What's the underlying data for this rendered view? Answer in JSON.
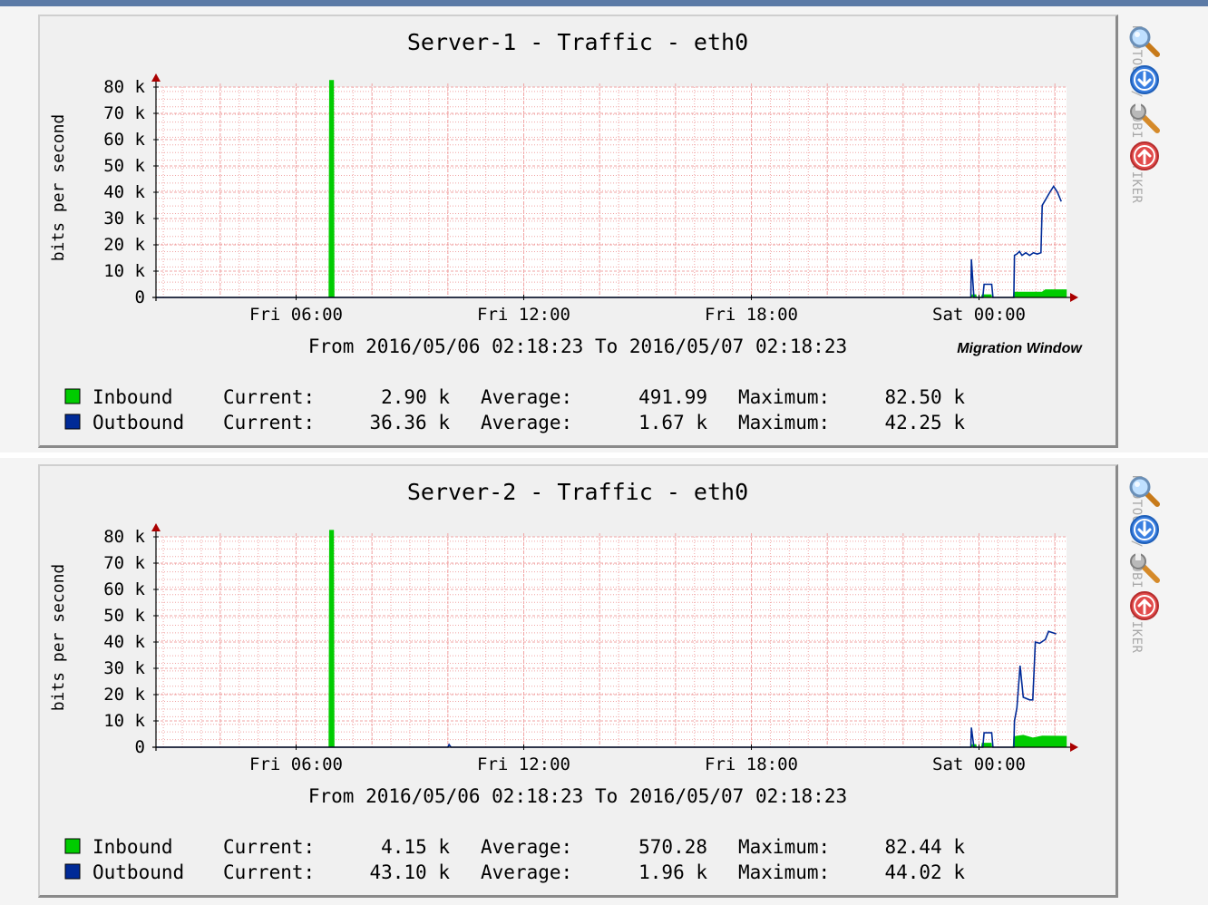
{
  "credit": "RRDTOOL / TOBI OETIKER",
  "tools": [
    "zoom-icon",
    "download-icon",
    "settings-icon",
    "upload-icon"
  ],
  "colors": {
    "inbound": "#00cc00",
    "outbound": "#002a97",
    "grid": "#f1a5a5",
    "axis": "#aa0000",
    "text": "#000000"
  },
  "chart_data": [
    {
      "type": "area",
      "title": "Server-1 - Traffic - eth0",
      "ylabel": "bits per second",
      "ylim": [
        0,
        80000
      ],
      "yticks": [
        0,
        10000,
        20000,
        30000,
        40000,
        50000,
        60000,
        70000,
        80000
      ],
      "ytick_labels": [
        "0",
        "10 k",
        "20 k",
        "30 k",
        "40 k",
        "50 k",
        "60 k",
        "70 k",
        "80 k"
      ],
      "xlim": [
        "2016-05-06 02:18:23",
        "2016-05-07 02:18:23"
      ],
      "xticks": [
        "2016-05-06 06:00",
        "2016-05-06 12:00",
        "2016-05-06 18:00",
        "2016-05-07 00:00"
      ],
      "xtick_labels": [
        "Fri 06:00",
        "Fri 12:00",
        "Fri 18:00",
        "Sat 00:00"
      ],
      "grid": true,
      "time_range": "From 2016/05/06 02:18:23 To 2016/05/07 02:18:23",
      "annotation": "Migration Window",
      "series": [
        {
          "name": "Inbound",
          "style": "area",
          "points": [
            [
              "2016-05-06 02:18:23",
              0
            ],
            [
              "2016-05-06 06:52",
              0
            ],
            [
              "2016-05-06 06:53",
              82500
            ],
            [
              "2016-05-06 06:59",
              82500
            ],
            [
              "2016-05-06 07:00",
              0
            ],
            [
              "2016-05-06 23:48",
              0
            ],
            [
              "2016-05-06 23:49",
              1000
            ],
            [
              "2016-05-06 23:55",
              1000
            ],
            [
              "2016-05-06 23:56",
              0
            ],
            [
              "2016-05-07 00:04",
              0
            ],
            [
              "2016-05-07 00:05",
              1000
            ],
            [
              "2016-05-07 00:19",
              1000
            ],
            [
              "2016-05-07 00:20",
              0
            ],
            [
              "2016-05-07 00:54",
              0
            ],
            [
              "2016-05-07 00:55",
              2000
            ],
            [
              "2016-05-07 01:40",
              2000
            ],
            [
              "2016-05-07 01:45",
              2900
            ],
            [
              "2016-05-07 02:18",
              2900
            ]
          ],
          "current": "2.90 k",
          "average": "491.99",
          "maximum": "82.50 k"
        },
        {
          "name": "Outbound",
          "style": "line",
          "points": [
            [
              "2016-05-06 02:18:23",
              0
            ],
            [
              "2016-05-06 23:47",
              0
            ],
            [
              "2016-05-06 23:48",
              14500
            ],
            [
              "2016-05-06 23:52",
              0
            ],
            [
              "2016-05-07 00:06",
              0
            ],
            [
              "2016-05-07 00:08",
              5000
            ],
            [
              "2016-05-07 00:20",
              5000
            ],
            [
              "2016-05-07 00:22",
              0
            ],
            [
              "2016-05-07 00:55",
              0
            ],
            [
              "2016-05-07 00:56",
              16000
            ],
            [
              "2016-05-07 01:00",
              16500
            ],
            [
              "2016-05-07 01:04",
              17500
            ],
            [
              "2016-05-07 01:08",
              16000
            ],
            [
              "2016-05-07 01:14",
              17000
            ],
            [
              "2016-05-07 01:20",
              16000
            ],
            [
              "2016-05-07 01:26",
              17000
            ],
            [
              "2016-05-07 01:32",
              16500
            ],
            [
              "2016-05-07 01:38",
              17000
            ],
            [
              "2016-05-07 01:40",
              35000
            ],
            [
              "2016-05-07 01:46",
              37500
            ],
            [
              "2016-05-07 01:52",
              40000
            ],
            [
              "2016-05-07 01:58",
              42250
            ],
            [
              "2016-05-07 02:04",
              40000
            ],
            [
              "2016-05-07 02:10",
              36500
            ]
          ],
          "current": "36.36 k",
          "average": "1.67 k",
          "maximum": "42.25 k"
        }
      ],
      "legend_labels": {
        "current": "Current:",
        "average": "Average:",
        "maximum": "Maximum:"
      }
    },
    {
      "type": "area",
      "title": "Server-2 - Traffic - eth0",
      "ylabel": "bits per second",
      "ylim": [
        0,
        80000
      ],
      "yticks": [
        0,
        10000,
        20000,
        30000,
        40000,
        50000,
        60000,
        70000,
        80000
      ],
      "ytick_labels": [
        "0",
        "10 k",
        "20 k",
        "30 k",
        "40 k",
        "50 k",
        "60 k",
        "70 k",
        "80 k"
      ],
      "xlim": [
        "2016-05-06 02:18:23",
        "2016-05-07 02:18:23"
      ],
      "xticks": [
        "2016-05-06 06:00",
        "2016-05-06 12:00",
        "2016-05-06 18:00",
        "2016-05-07 00:00"
      ],
      "xtick_labels": [
        "Fri 06:00",
        "Fri 12:00",
        "Fri 18:00",
        "Sat 00:00"
      ],
      "grid": true,
      "time_range": "From 2016/05/06 02:18:23 To 2016/05/07 02:18:23",
      "annotation": "",
      "series": [
        {
          "name": "Inbound",
          "style": "area",
          "points": [
            [
              "2016-05-06 02:18:23",
              0
            ],
            [
              "2016-05-06 06:52",
              0
            ],
            [
              "2016-05-06 06:53",
              82440
            ],
            [
              "2016-05-06 06:59",
              82440
            ],
            [
              "2016-05-06 07:00",
              0
            ],
            [
              "2016-05-06 23:48",
              0
            ],
            [
              "2016-05-06 23:49",
              1000
            ],
            [
              "2016-05-06 23:55",
              1000
            ],
            [
              "2016-05-06 23:56",
              0
            ],
            [
              "2016-05-07 00:04",
              0
            ],
            [
              "2016-05-07 00:05",
              1500
            ],
            [
              "2016-05-07 00:19",
              1500
            ],
            [
              "2016-05-07 00:20",
              0
            ],
            [
              "2016-05-07 00:54",
              0
            ],
            [
              "2016-05-07 00:55",
              4000
            ],
            [
              "2016-05-07 01:10",
              4500
            ],
            [
              "2016-05-07 01:25",
              3500
            ],
            [
              "2016-05-07 01:40",
              4200
            ],
            [
              "2016-05-07 02:18",
              4150
            ]
          ],
          "current": "4.15 k",
          "average": "570.28",
          "maximum": "82.44 k"
        },
        {
          "name": "Outbound",
          "style": "line",
          "points": [
            [
              "2016-05-06 02:18:23",
              0
            ],
            [
              "2016-05-06 10:00",
              0
            ],
            [
              "2016-05-06 10:02",
              1000
            ],
            [
              "2016-05-06 10:05",
              0
            ],
            [
              "2016-05-06 23:47",
              0
            ],
            [
              "2016-05-06 23:48",
              7500
            ],
            [
              "2016-05-06 23:52",
              0
            ],
            [
              "2016-05-07 00:06",
              0
            ],
            [
              "2016-05-07 00:08",
              5500
            ],
            [
              "2016-05-07 00:20",
              5500
            ],
            [
              "2016-05-07 00:22",
              0
            ],
            [
              "2016-05-07 00:55",
              0
            ],
            [
              "2016-05-07 00:56",
              10000
            ],
            [
              "2016-05-07 01:00",
              15000
            ],
            [
              "2016-05-07 01:05",
              31000
            ],
            [
              "2016-05-07 01:10",
              19000
            ],
            [
              "2016-05-07 01:20",
              18000
            ],
            [
              "2016-05-07 01:25",
              18000
            ],
            [
              "2016-05-07 01:29",
              40000
            ],
            [
              "2016-05-07 01:36",
              39500
            ],
            [
              "2016-05-07 01:45",
              41000
            ],
            [
              "2016-05-07 01:50",
              44020
            ],
            [
              "2016-05-07 02:02",
              43100
            ]
          ],
          "current": "43.10 k",
          "average": "1.96 k",
          "maximum": "44.02 k"
        }
      ],
      "legend_labels": {
        "current": "Current:",
        "average": "Average:",
        "maximum": "Maximum:"
      }
    }
  ]
}
